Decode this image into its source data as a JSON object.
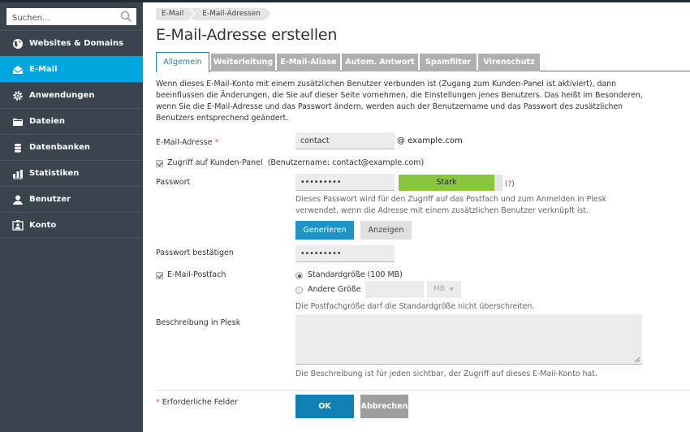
{
  "search": {
    "placeholder": "Suchen..."
  },
  "sidebar": {
    "items": [
      {
        "label": "Websites & Domains",
        "icon": "globe-icon",
        "active": false
      },
      {
        "label": "E-Mail",
        "icon": "envelope-icon",
        "active": true
      },
      {
        "label": "Anwendungen",
        "icon": "gear-icon",
        "active": false
      },
      {
        "label": "Dateien",
        "icon": "folder-icon",
        "active": false
      },
      {
        "label": "Datenbanken",
        "icon": "database-icon",
        "active": false
      },
      {
        "label": "Statistiken",
        "icon": "bar-chart-icon",
        "active": false
      },
      {
        "label": "Benutzer",
        "icon": "user-icon",
        "active": false
      },
      {
        "label": "Konto",
        "icon": "account-icon",
        "active": false
      }
    ]
  },
  "breadcrumb": [
    "E-Mail",
    "E-Mail-Adressen"
  ],
  "page": {
    "title": "E-Mail-Adresse erstellen"
  },
  "tabs": [
    "Allgemein",
    "Weiterleitung",
    "E-Mail-Aliase",
    "Autom. Antwort",
    "Spamfilter",
    "Virenschutz"
  ],
  "intro": "Wenn dieses E-Mail-Konto mit einem zusätzlichen Benutzer verbunden ist (Zugang zum Kunden-Panel ist aktiviert), dann beeinflussen die Änderungen, die Sie auf dieser Seite vornehmen, die Einstellungen jenes Benutzers. Das heißt im Besonderen, wenn Sie die E-Mail-Adresse und das Passwort ändern, werden auch der Benutzername und das Passwort des zusätzlichen Benutzers entsprechend geändert.",
  "form": {
    "email_label": "E-Mail-Adresse",
    "required_mark": "*",
    "email_value": "contact",
    "domain": "@ example.com",
    "panel_access_label": "Zugriff auf Kunden-Panel",
    "panel_access_checked": true,
    "panel_access_note": "(Benutzername: contact@example.com)",
    "password_label": "Passwort",
    "password_value": "•••••••••",
    "strength_label": "Stark",
    "strength_level": 0.92,
    "strength_color": "#87c63d",
    "help_label": "(?)",
    "password_hint": "Dieses Passwort wird für den Zugriff auf das Postfach und zum Anmelden in Plesk verwendet, wenn die Adresse mit einem zusätzlichen Benutzer verknüpft ist.",
    "generate_label": "Generieren",
    "show_label": "Anzeigen",
    "confirm_label": "Passwort bestätigen",
    "confirm_value": "•••••••••",
    "mailbox_label": "E-Mail-Postfach",
    "mailbox_checked": true,
    "size_default_label": "Standardgröße (100 MB)",
    "size_default_selected": true,
    "size_other_label": "Andere Größe",
    "size_other_value": "",
    "size_unit": "MB",
    "size_hint": "Die Postfachgröße darf die Standardgröße nicht überschreiten.",
    "description_label": "Beschreibung in Plesk",
    "description_value": "",
    "description_hint": "Die Beschreibung ist für jeden sichtbar, der Zugriff auf dieses E-Mail-Konto hat.",
    "required_note": "Erforderliche Felder",
    "ok_label": "OK",
    "cancel_label": "Abbrechen"
  }
}
